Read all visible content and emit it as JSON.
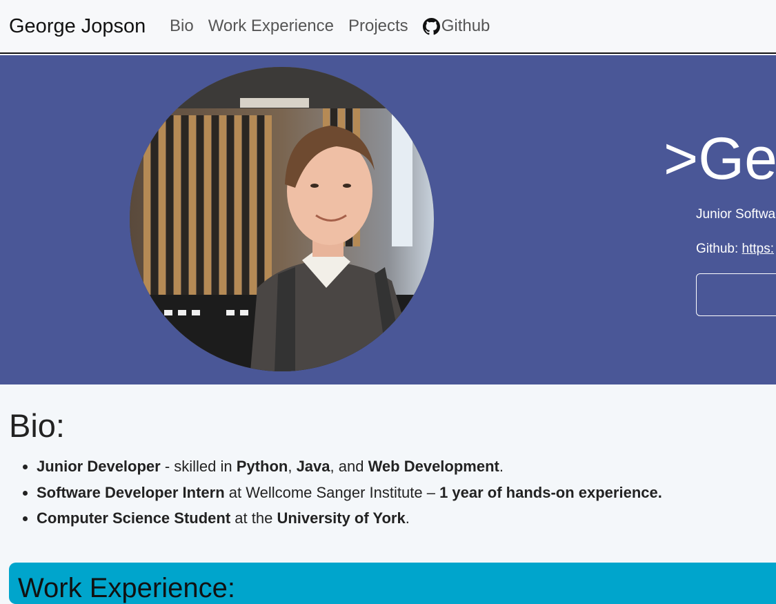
{
  "nav": {
    "brand": "George Jopson",
    "links": [
      "Bio",
      "Work Experience",
      "Projects"
    ],
    "github_label": "Github",
    "github_icon": "github-icon"
  },
  "hero": {
    "title": ">Geo",
    "subtitle": "Junior Softwa",
    "github_prefix": "Github: ",
    "github_link": "https:"
  },
  "bio": {
    "heading": "Bio:",
    "items": [
      {
        "role": "Junior Developer",
        "text1": " - skilled in ",
        "skill1": "Python",
        "sep1": ", ",
        "skill2": "Java",
        "sep2": ", and ",
        "skill3": "Web Development",
        "end": "."
      },
      {
        "role": "Software Developer Intern",
        "text1": " at Wellcome Sanger Institute – ",
        "highlight": "1 year of hands-on experience."
      },
      {
        "role": "Computer Science Student",
        "text1": " at the ",
        "place": "University of York",
        "end": "."
      }
    ]
  },
  "work": {
    "heading": "Work Experience:"
  },
  "colors": {
    "hero_bg": "#4a5797",
    "work_bg": "#00a5cc",
    "page_bg": "#f4f7fa"
  }
}
